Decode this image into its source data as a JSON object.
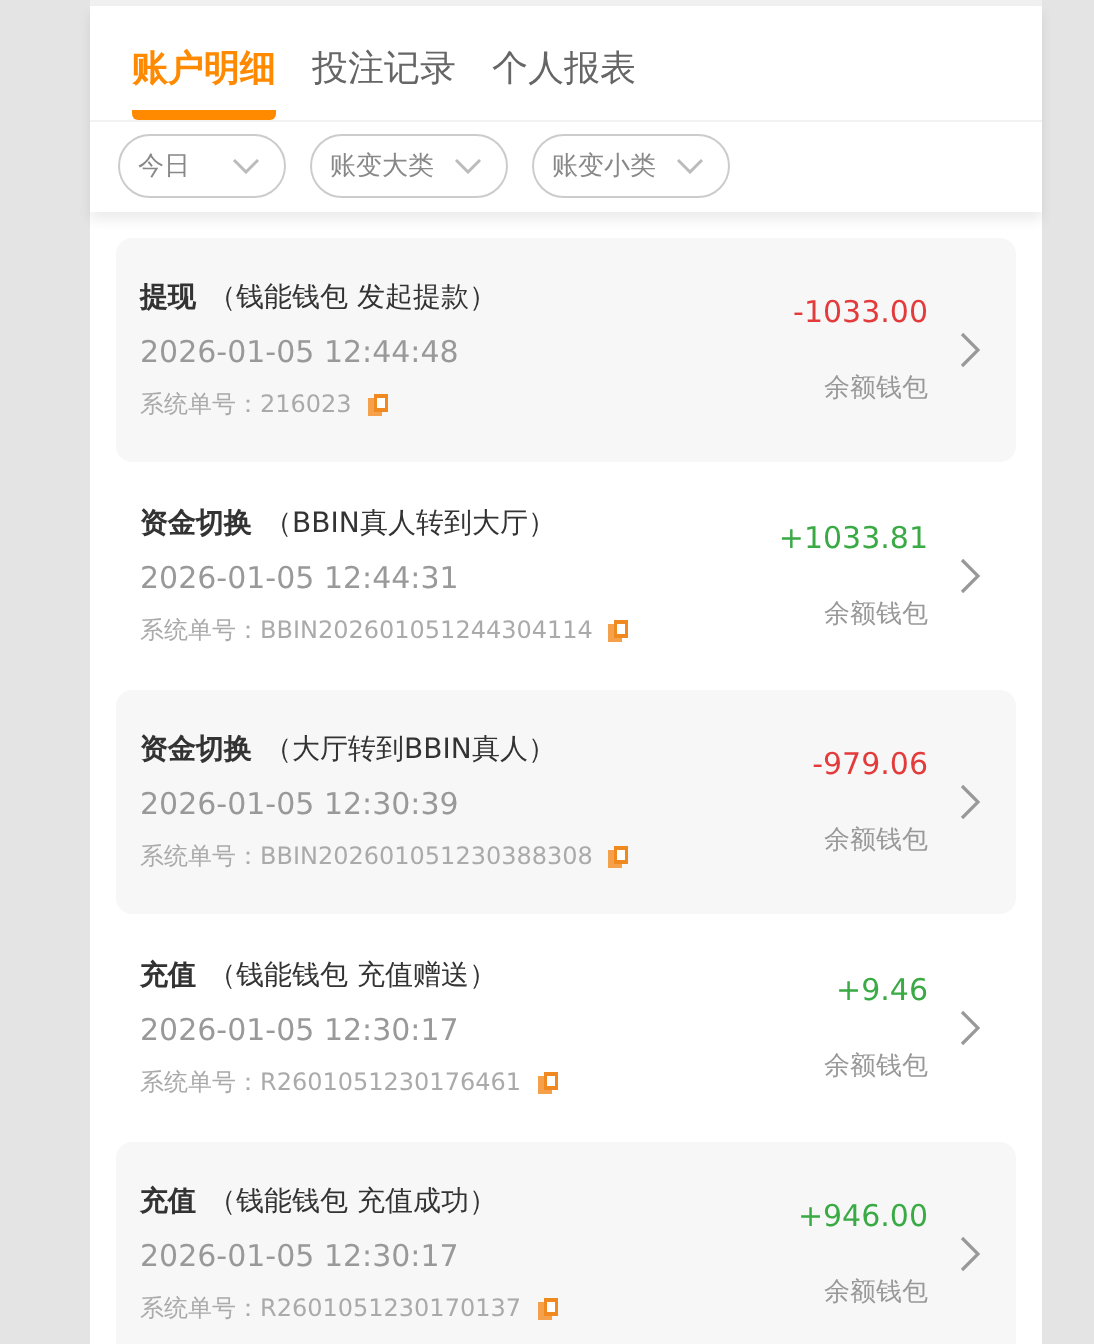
{
  "tabs": [
    {
      "label": "账户明细",
      "selected": true
    },
    {
      "label": "投注记录",
      "selected": false
    },
    {
      "label": "个人报表",
      "selected": false
    }
  ],
  "filters": [
    {
      "label": "今日"
    },
    {
      "label": "账变大类"
    },
    {
      "label": "账变小类"
    }
  ],
  "records": [
    {
      "title": "提现",
      "detail": "（钱能钱包 发起提款）",
      "time": "2026-01-05 12:44:48",
      "order": "系统单号：216023",
      "amount": "-1033.00",
      "kind": "debit",
      "wallet": "余额钱包"
    },
    {
      "title": "资金切换",
      "detail": "（BBIN真人转到大厅）",
      "time": "2026-01-05 12:44:31",
      "order": "系统单号：BBIN202601051244304114",
      "amount": "+1033.81",
      "kind": "credit",
      "wallet": "余额钱包"
    },
    {
      "title": "资金切换",
      "detail": "（大厅转到BBIN真人）",
      "time": "2026-01-05 12:30:39",
      "order": "系统单号：BBIN202601051230388308",
      "amount": "-979.06",
      "kind": "debit",
      "wallet": "余额钱包"
    },
    {
      "title": "充值",
      "detail": "（钱能钱包 充值赠送）",
      "time": "2026-01-05 12:30:17",
      "order": "系统单号：R2601051230176461",
      "amount": "+9.46",
      "kind": "credit",
      "wallet": "余额钱包"
    },
    {
      "title": "充值",
      "detail": "（钱能钱包 充值成功）",
      "time": "2026-01-05 12:30:17",
      "order": "系统单号：R2601051230170137",
      "amount": "+946.00",
      "kind": "credit",
      "wallet": "余额钱包"
    }
  ]
}
